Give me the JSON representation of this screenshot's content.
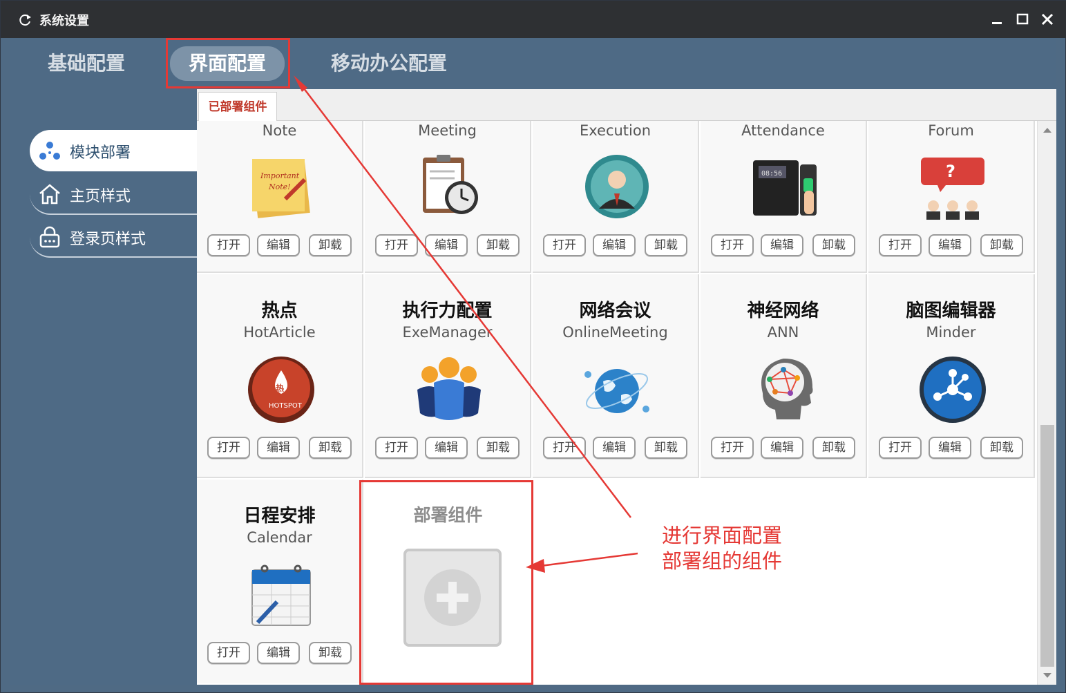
{
  "window": {
    "title": "系统设置"
  },
  "top_tabs": [
    {
      "label": "基础配置"
    },
    {
      "label": "界面配置",
      "active": true
    },
    {
      "label": "移动办公配置"
    }
  ],
  "sidebar": {
    "items": [
      {
        "label": "模块部署",
        "icon": "module-deploy-icon",
        "active": true
      },
      {
        "label": "主页样式",
        "icon": "home-icon"
      },
      {
        "label": "登录页样式",
        "icon": "lock-icon"
      }
    ]
  },
  "subtab": {
    "label": "已部署组件"
  },
  "buttons": {
    "open": "打开",
    "edit": "编辑",
    "uninstall": "卸载"
  },
  "components": [
    {
      "en": "Note",
      "icon": "sticky-note-icon"
    },
    {
      "en": "Meeting",
      "icon": "clipboard-clock-icon"
    },
    {
      "en": "Execution",
      "icon": "person-badge-icon"
    },
    {
      "en": "Attendance",
      "icon": "fingerprint-device-icon"
    },
    {
      "en": "Forum",
      "icon": "discussion-icon"
    },
    {
      "cn": "热点",
      "en": "HotArticle",
      "icon": "hotspot-icon"
    },
    {
      "cn": "执行力配置",
      "en": "ExeManager",
      "icon": "team-people-icon"
    },
    {
      "cn": "网络会议",
      "en": "OnlineMeeting",
      "icon": "globe-network-icon"
    },
    {
      "cn": "神经网络",
      "en": "ANN",
      "icon": "brain-icon"
    },
    {
      "cn": "脑图编辑器",
      "en": "Minder",
      "icon": "mindmap-icon"
    },
    {
      "cn": "日程安排",
      "en": "Calendar",
      "icon": "calendar-icon"
    }
  ],
  "add_tile": {
    "label": "部署组件"
  },
  "annotation": {
    "line1": "进行界面配置",
    "line2": "部署组的组件",
    "color": "#e53935"
  },
  "colors": {
    "panel": "#4e6a85",
    "active_tab": "#7d93a8",
    "accent_red": "#c0392b"
  }
}
